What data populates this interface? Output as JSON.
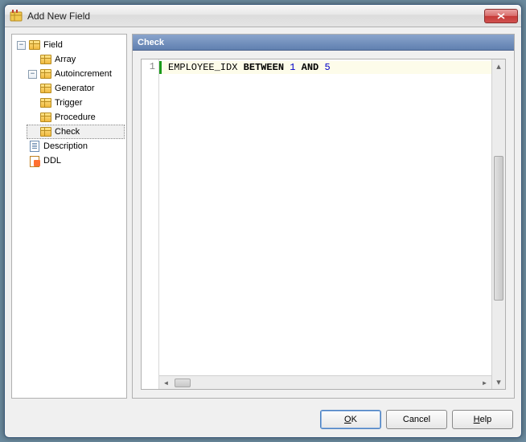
{
  "window": {
    "title": "Add New Field"
  },
  "tree": {
    "field": "Field",
    "array": "Array",
    "autoincrement": "Autoincrement",
    "generator": "Generator",
    "trigger": "Trigger",
    "procedure": "Procedure",
    "check": "Check",
    "description": "Description",
    "ddl": "DDL"
  },
  "panel": {
    "header": "Check"
  },
  "editor": {
    "line_number": "1",
    "tok_identifier": "EMPLOYEE_IDX ",
    "tok_between": "BETWEEN",
    "tok_space": " ",
    "tok_one": "1",
    "tok_and": "AND",
    "tok_five": "5"
  },
  "buttons": {
    "ok_prefix": "O",
    "ok_suffix": "K",
    "cancel": "Cancel",
    "help_prefix": "H",
    "help_suffix": "elp"
  }
}
